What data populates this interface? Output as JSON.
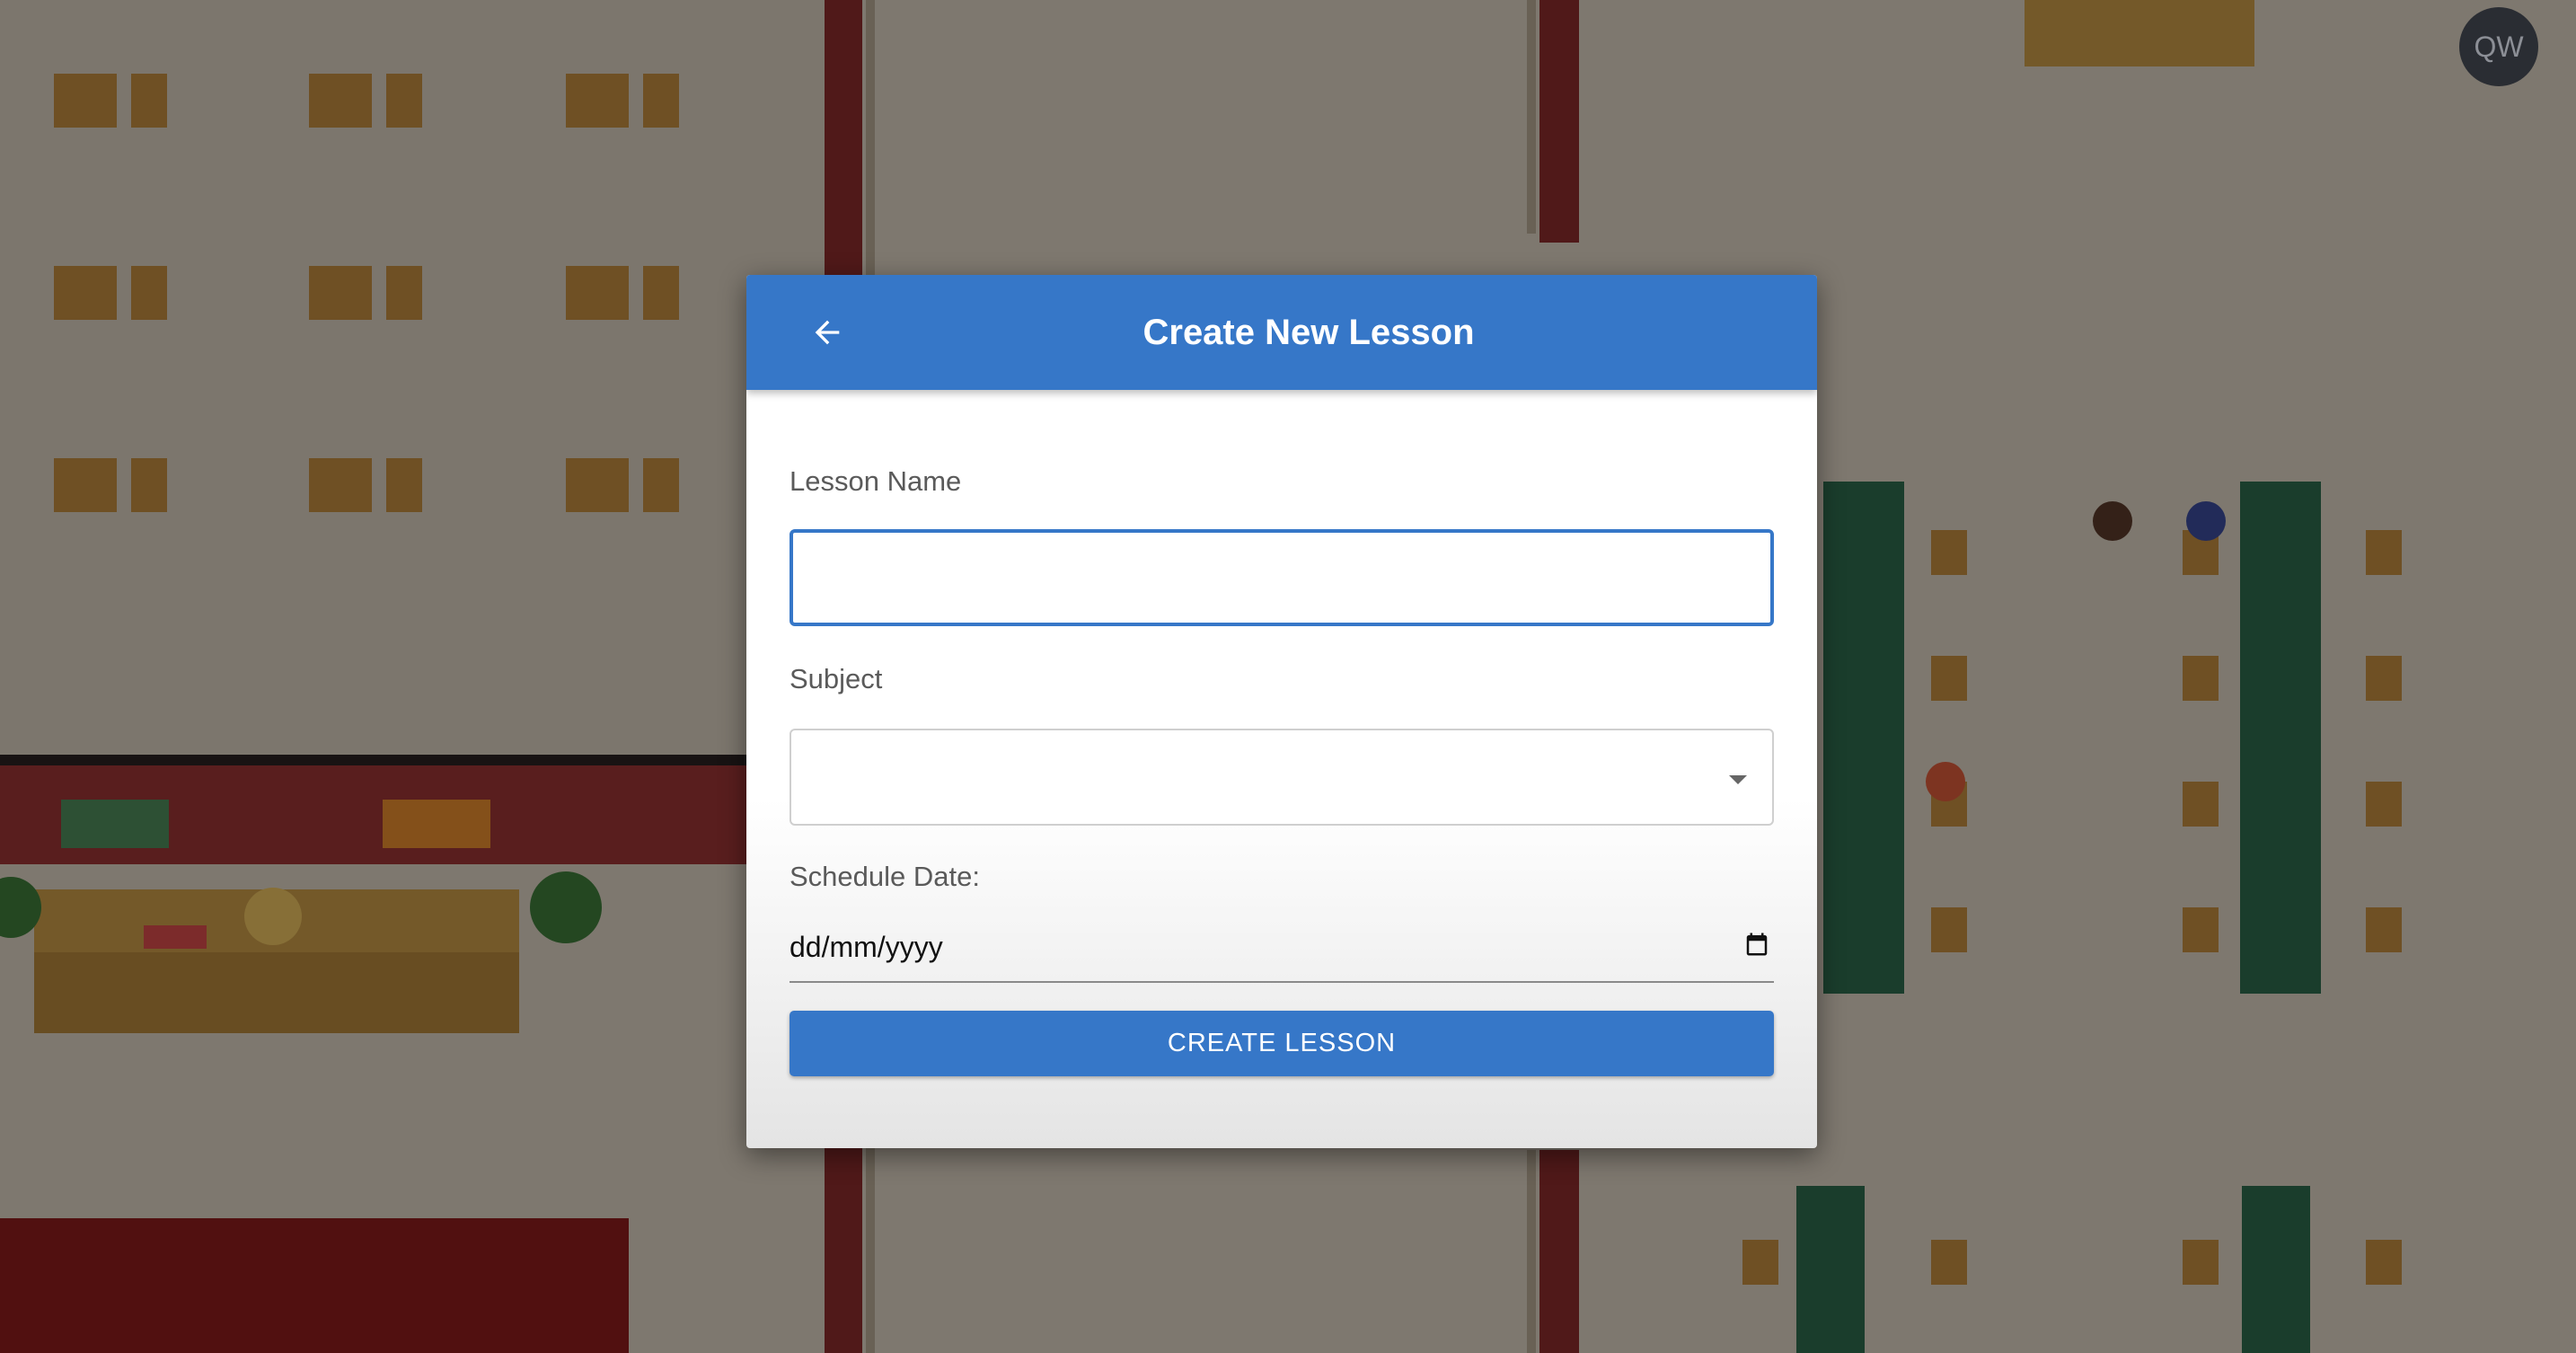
{
  "avatar": {
    "initials": "QW"
  },
  "modal": {
    "title": "Create New Lesson",
    "back_icon": "arrow-left-icon",
    "lesson_name": {
      "label": "Lesson Name",
      "value": "",
      "placeholder": ""
    },
    "subject": {
      "label": "Subject",
      "selected": "",
      "icon": "caret-down-icon"
    },
    "schedule_date": {
      "label": "Schedule Date:",
      "placeholder": "dd/mm/yyyy",
      "icon": "calendar-icon"
    },
    "submit_label": "CREATE LESSON"
  },
  "colors": {
    "primary": "#3677c8",
    "header_text": "#ffffff",
    "label_text": "#5a5a5a",
    "overlay": "rgba(0,0,0,0.42)"
  }
}
